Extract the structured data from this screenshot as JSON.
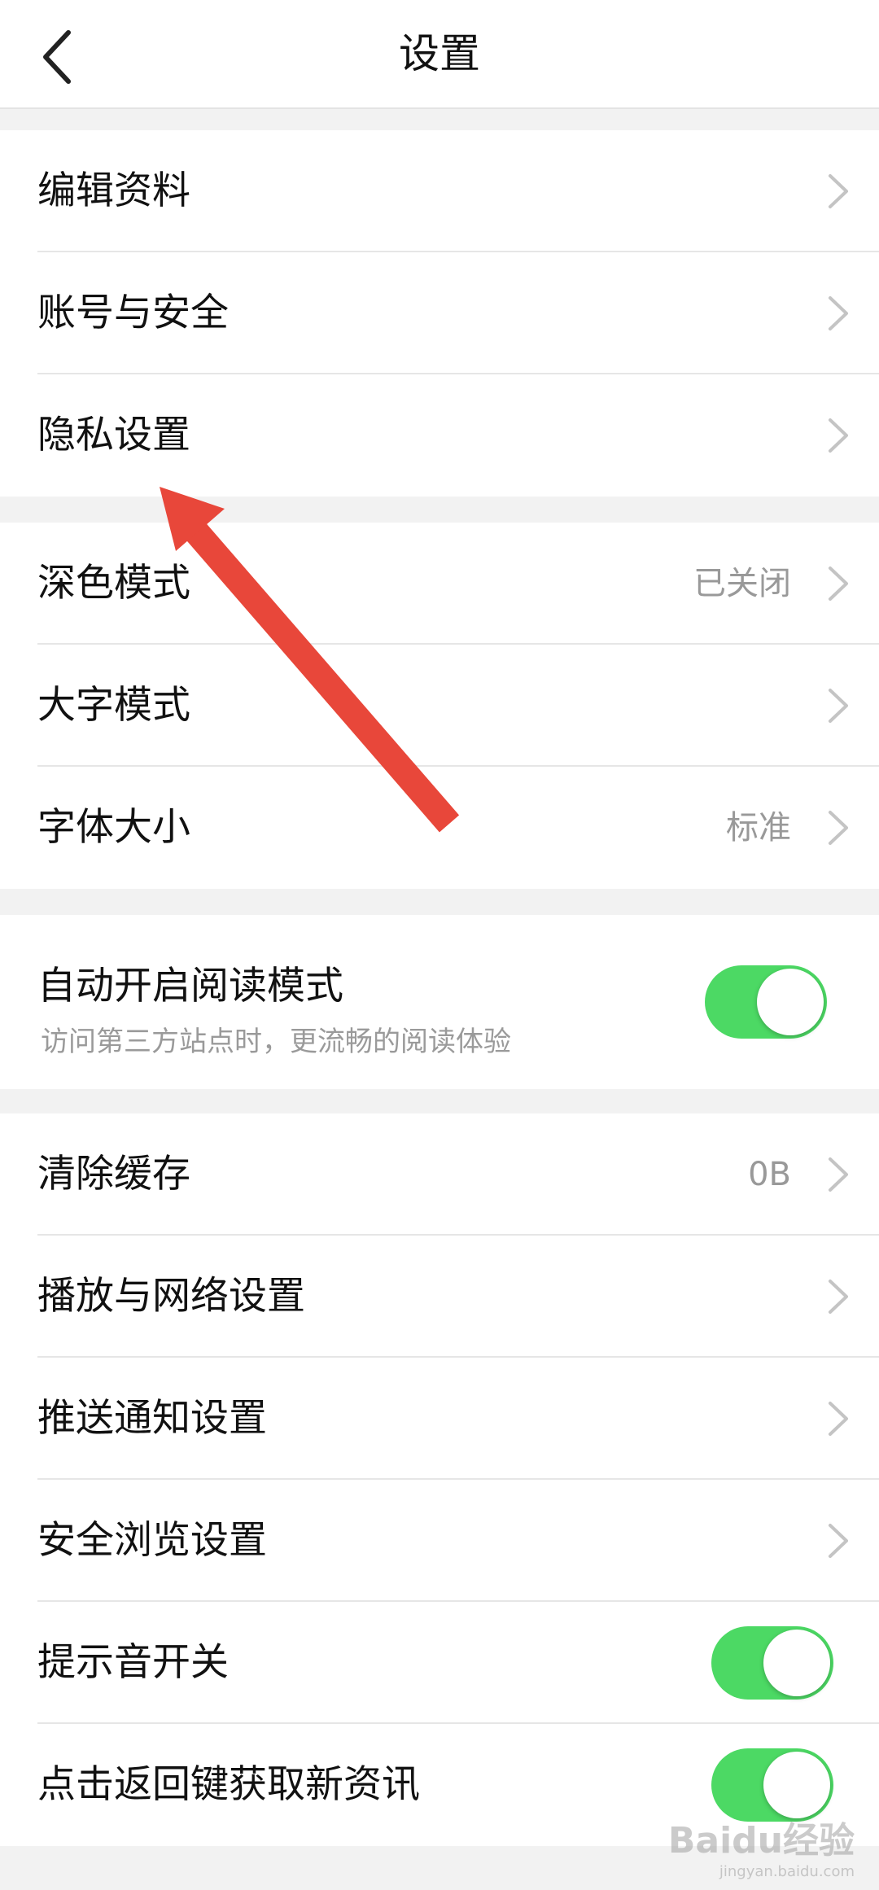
{
  "header": {
    "title": "设置"
  },
  "groups": [
    {
      "items": [
        {
          "label": "编辑资料"
        },
        {
          "label": "账号与安全"
        },
        {
          "label": "隐私设置"
        }
      ]
    },
    {
      "items": [
        {
          "label": "深色模式",
          "value": "已关闭"
        },
        {
          "label": "大字模式"
        },
        {
          "label": "字体大小",
          "value": "标准"
        }
      ]
    },
    {
      "items": [
        {
          "label": "自动开启阅读模式",
          "sub": "访问第三方站点时，更流畅的阅读体验",
          "toggle": true
        }
      ]
    },
    {
      "items": [
        {
          "label": "清除缓存",
          "value": "0B"
        },
        {
          "label": "播放与网络设置"
        },
        {
          "label": "推送通知设置"
        },
        {
          "label": "安全浏览设置"
        },
        {
          "label": "提示音开关",
          "toggle": true
        },
        {
          "label": "点击返回键获取新资讯",
          "toggle": true
        }
      ]
    }
  ],
  "colors": {
    "toggle_on": "#4cd964",
    "annotation_arrow": "#e8473a"
  },
  "watermark": {
    "logo": "Baidu经验",
    "url": "jingyan.baidu.com"
  }
}
